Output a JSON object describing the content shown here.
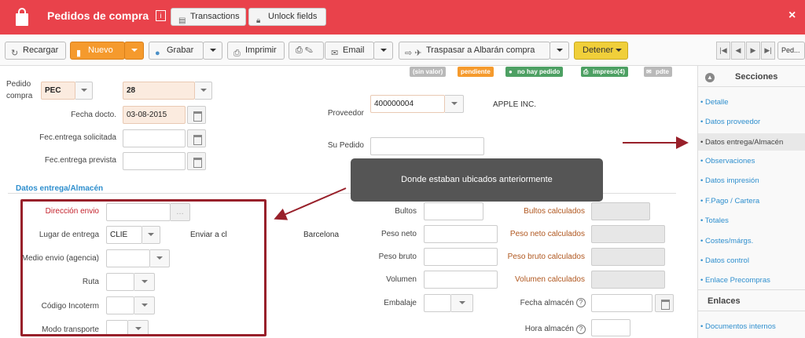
{
  "header": {
    "title": "Pedidos de compra",
    "info_icon": "i",
    "transactions_label": "Transactions",
    "unlock_label": "Unlock fields",
    "close_label": "×"
  },
  "toolbar": {
    "recargar": "Recargar",
    "nuevo": "Nuevo",
    "grabar": "Grabar",
    "imprimir": "Imprimir",
    "email": "Email",
    "traspasar": "Traspasar a Albarán compra",
    "detener": "Detener",
    "nav_ped": "Ped..."
  },
  "status": {
    "sin_valor": "(sin valor)",
    "pendiente": "pendiente",
    "no_hay_pedido": "no hay pedido",
    "impreso": "impreso(4)",
    "pdte": "pdte"
  },
  "form": {
    "pedido_label_1": "Pedido",
    "pedido_label_2": "compra",
    "pedido_serie": "PEC",
    "pedido_num": "28",
    "fecha_docto_label": "Fecha docto.",
    "fecha_docto": "03-08-2015",
    "fec_solicitada_label": "Fec.entrega solicitada",
    "fec_prevista_label": "Fec.entrega prevista",
    "proveedor_label": "Proveedor",
    "proveedor": "400000004",
    "proveedor_nombre": "APPLE INC.",
    "su_pedido_label": "Su Pedido"
  },
  "section": {
    "title": "Datos entrega/Almacén",
    "direccion_label": "Dirección envio",
    "lugar_label": "Lugar de entrega",
    "lugar_value": "CLIE",
    "enviar_label": "Enviar a cl",
    "barcelona": "Barcelona",
    "medio_label": "Medio envio (agencia)",
    "ruta_label": "Ruta",
    "incoterm_label": "Código Incoterm",
    "modo_label": "Modo transporte",
    "bultos_label": "Bultos",
    "peso_neto_label": "Peso neto",
    "peso_bruto_label": "Peso bruto",
    "volumen_label": "Volumen",
    "embalaje_label": "Embalaje",
    "bultos_calc_label": "Bultos calculados",
    "peso_neto_calc_label": "Peso neto calculados",
    "peso_bruto_calc_label": "Peso bruto calculados",
    "volumen_calc_label": "Volumen calculados",
    "fecha_almacen_label": "Fecha almacén",
    "hora_almacen_label": "Hora almacén"
  },
  "tooltip": "Donde estaban ubicados anteriormente",
  "sidebar": {
    "secciones": "Secciones",
    "enlaces": "Enlaces",
    "items": [
      "• Detalle",
      "• Datos proveedor",
      "• Datos entrega/Almacén",
      "• Observaciones",
      "• Datos impresión",
      "• F.Pago / Cartera",
      "• Totales",
      "• Costes/márgs.",
      "• Datos control",
      "• Enlace Precompras"
    ],
    "enlaces_items": [
      "• Documentos internos"
    ]
  },
  "colors": {
    "brand_red": "#e9424b",
    "accent_blue": "#2f8fce",
    "nuevo_orange": "#f59a2d",
    "detener_yellow": "#f0cf3a",
    "annotation_red": "#98202a"
  }
}
